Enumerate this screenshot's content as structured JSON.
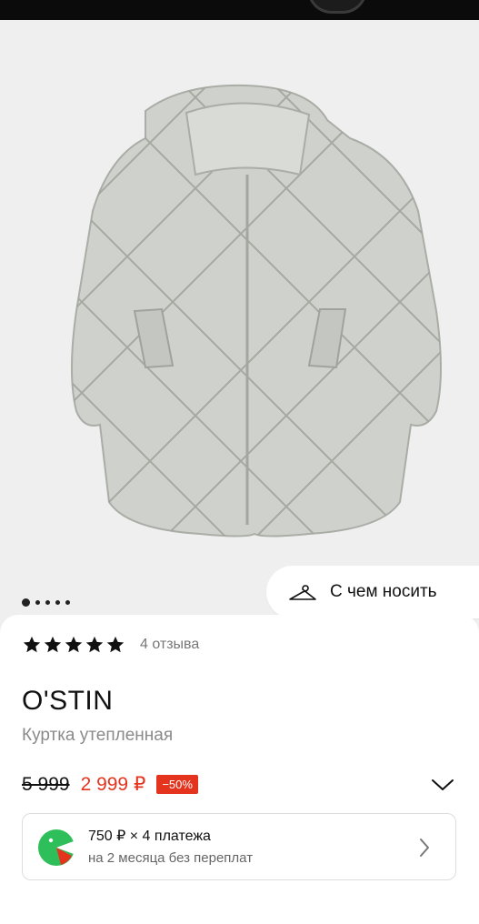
{
  "gallery": {
    "image_alt": "Куртка утепленная",
    "slides_total": 5,
    "slide_active": 1,
    "outfit_button": {
      "label": "С чем носить",
      "icon": "hanger-icon"
    }
  },
  "product": {
    "rating": {
      "stars": 5,
      "reviews_label": "4 отзыва"
    },
    "brand": "O'STIN",
    "name": "Куртка утепленная",
    "price": {
      "old": "5 999",
      "current": "2 999 ₽",
      "discount": "−50%"
    },
    "installment": {
      "title": "750 ₽ × 4 платежа",
      "subtitle": "на 2 месяца без переплат",
      "icon": "split-payment-icon"
    }
  },
  "colors": {
    "accent": "#e4341e",
    "installment_green": "#2fbf5a"
  }
}
